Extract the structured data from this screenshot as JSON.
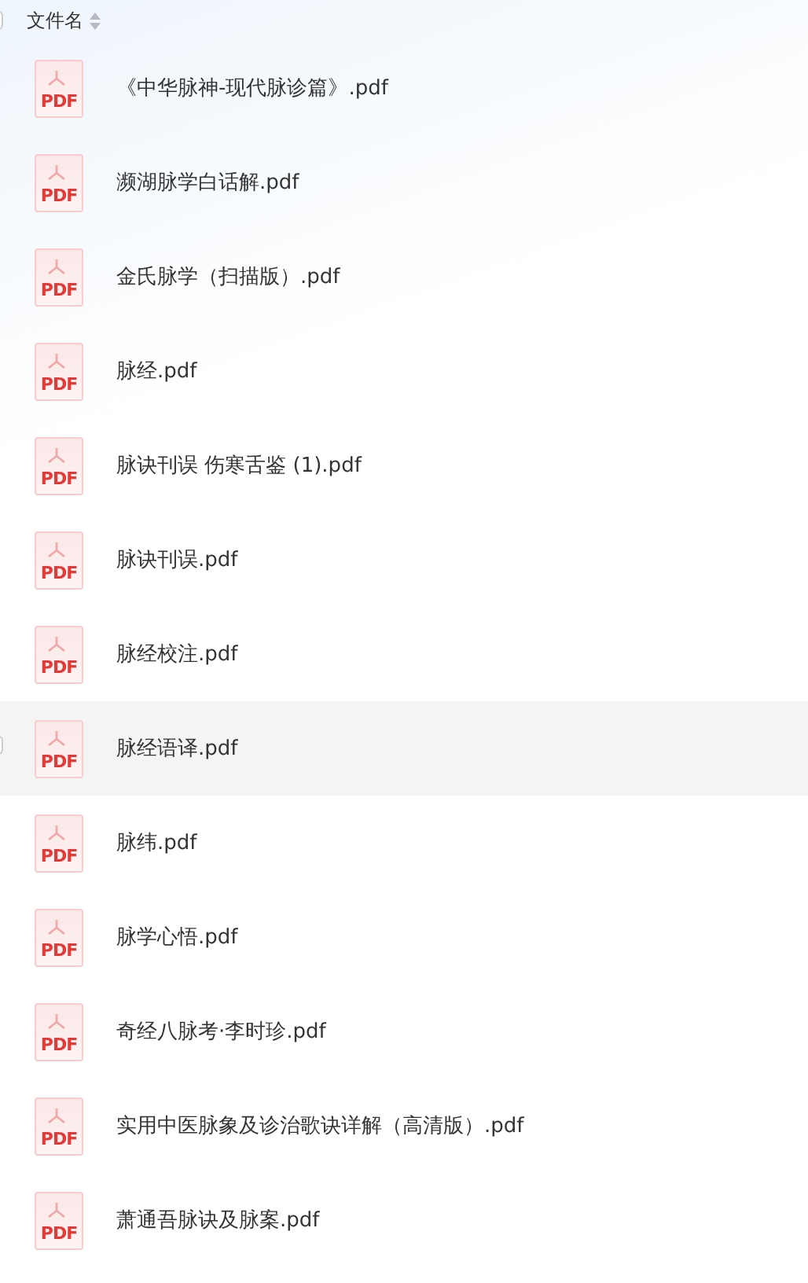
{
  "header": {
    "label": "文件名",
    "checkbox": {
      "checked": false
    }
  },
  "files": [
    {
      "name": "《中华脉神-现代脉诊篇》.pdf",
      "icon_text": "PDF",
      "hovered": false
    },
    {
      "name": "濒湖脉学白话解.pdf",
      "icon_text": "PDF",
      "hovered": false
    },
    {
      "name": "金氏脉学（扫描版）.pdf",
      "icon_text": "PDF",
      "hovered": false
    },
    {
      "name": "脉经.pdf",
      "icon_text": "PDF",
      "hovered": false
    },
    {
      "name": "脉诀刊误 伤寒舌鉴 (1).pdf",
      "icon_text": "PDF",
      "hovered": false
    },
    {
      "name": "脉诀刊误.pdf",
      "icon_text": "PDF",
      "hovered": false
    },
    {
      "name": "脉经校注.pdf",
      "icon_text": "PDF",
      "hovered": false
    },
    {
      "name": "脉经语译.pdf",
      "icon_text": "PDF",
      "hovered": true
    },
    {
      "name": "脉纬.pdf",
      "icon_text": "PDF",
      "hovered": false
    },
    {
      "name": "脉学心悟.pdf",
      "icon_text": "PDF",
      "hovered": false
    },
    {
      "name": "奇经八脉考·李时珍.pdf",
      "icon_text": "PDF",
      "hovered": false
    },
    {
      "name": "实用中医脉象及诊治歌诀详解（高清版）.pdf",
      "icon_text": "PDF",
      "hovered": false
    },
    {
      "name": "萧通吾脉诀及脉案.pdf",
      "icon_text": "PDF",
      "hovered": false
    }
  ]
}
